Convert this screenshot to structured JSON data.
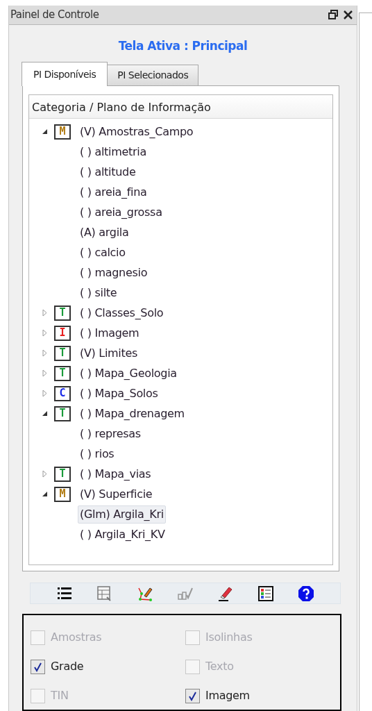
{
  "window": {
    "title": "Painel de Controle"
  },
  "active_screen": "Tela Ativa : Principal",
  "tabs": [
    {
      "label": "PI Disponíveis",
      "selected": true
    },
    {
      "label": "PI Selecionados",
      "selected": false
    }
  ],
  "tree": {
    "header": "Categoria / Plano de Informação",
    "items": [
      {
        "label": "(V) Amostras_Campo",
        "badge": "M",
        "color": "#b07a10",
        "expanded": true,
        "selected": false,
        "children": [
          {
            "label": "( ) altimetria",
            "selected": false
          },
          {
            "label": "( ) altitude",
            "selected": false
          },
          {
            "label": "( ) areia_fina",
            "selected": false
          },
          {
            "label": "( ) areia_grossa",
            "selected": false
          },
          {
            "label": "(A) argila",
            "selected": false
          },
          {
            "label": "( ) calcio",
            "selected": false
          },
          {
            "label": "( ) magnesio",
            "selected": false
          },
          {
            "label": "( ) silte",
            "selected": false
          }
        ]
      },
      {
        "label": "( ) Classes_Solo",
        "badge": "T",
        "color": "#1a9a3a",
        "expanded": false,
        "selected": false
      },
      {
        "label": "( ) Imagem",
        "badge": "I",
        "color": "#e82020",
        "expanded": false,
        "selected": false
      },
      {
        "label": "(V) Limites",
        "badge": "T",
        "color": "#1a9a3a",
        "expanded": false,
        "selected": false
      },
      {
        "label": "( ) Mapa_Geologia",
        "badge": "T",
        "color": "#1a9a3a",
        "expanded": false,
        "selected": false
      },
      {
        "label": "( ) Mapa_Solos",
        "badge": "C",
        "color": "#1a2ae8",
        "expanded": false,
        "selected": false
      },
      {
        "label": "( ) Mapa_drenagem",
        "badge": "T",
        "color": "#1a9a3a",
        "expanded": true,
        "selected": false,
        "children": [
          {
            "label": "( ) represas",
            "selected": false
          },
          {
            "label": "( ) rios",
            "selected": false
          }
        ]
      },
      {
        "label": "( ) Mapa_vias",
        "badge": "T",
        "color": "#1a9a3a",
        "expanded": false,
        "selected": false
      },
      {
        "label": "(V) Superficie",
        "badge": "M",
        "color": "#b07a10",
        "expanded": true,
        "selected": false,
        "children": [
          {
            "label": "(Glm) Argila_Kri",
            "selected": true
          },
          {
            "label": "( ) Argila_Kri_KV",
            "selected": false
          }
        ]
      }
    ]
  },
  "toolbar": [
    {
      "kind": "list"
    },
    {
      "kind": "table"
    },
    {
      "kind": "nodes"
    },
    {
      "kind": "chart"
    },
    {
      "kind": "eraser"
    },
    {
      "kind": "legend"
    },
    {
      "kind": "help"
    }
  ],
  "display_options": [
    {
      "label": "Amostras",
      "checked": false,
      "disabled": true
    },
    {
      "label": "Isolinhas",
      "checked": false,
      "disabled": true
    },
    {
      "label": "Grade",
      "checked": true,
      "disabled": false
    },
    {
      "label": "Texto",
      "checked": false,
      "disabled": true
    },
    {
      "label": "TIN",
      "checked": false,
      "disabled": true
    },
    {
      "label": "Imagem",
      "checked": true,
      "disabled": false
    }
  ]
}
